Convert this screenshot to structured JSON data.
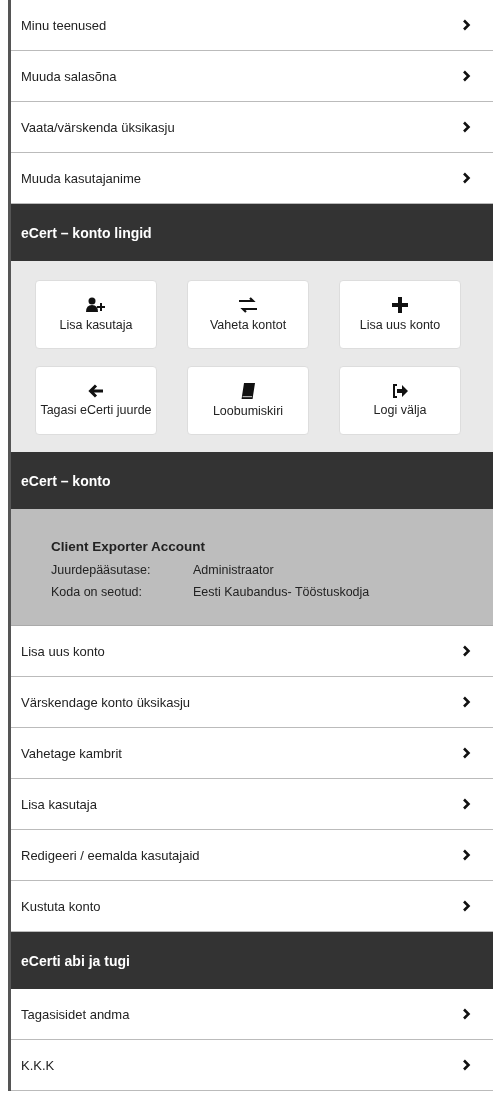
{
  "sections": [
    {
      "kind": "links",
      "items": [
        "Minu teenused",
        "Muuda salasõna",
        "Vaata/värskenda üksikasju",
        "Muuda kasutajanime"
      ]
    },
    {
      "kind": "header",
      "title": "eCert – konto lingid"
    },
    {
      "kind": "buttons",
      "items": [
        "Lisa kasutaja",
        "Vaheta kontot",
        "Lisa uus konto",
        "Tagasi eCerti juurde",
        "Loobumiskiri",
        "Logi välja"
      ]
    },
    {
      "kind": "header",
      "title": "eCert – konto"
    },
    {
      "kind": "account",
      "name": "Client Exporter Account",
      "fields": [
        {
          "label": "Juurdepääsutase:",
          "value": "Administraator"
        },
        {
          "label": "Koda on seotud:",
          "value": "Eesti Kaubandus- Tööstuskodja"
        }
      ]
    },
    {
      "kind": "links",
      "items": [
        "Lisa uus konto",
        "Värskendage konto üksikasju",
        "Vahetage kambrit",
        "Lisa kasutaja",
        "Redigeeri / eemalda kasutajaid",
        "Kustuta konto"
      ]
    },
    {
      "kind": "header",
      "title": "eCerti abi ja tugi"
    },
    {
      "kind": "links",
      "items": [
        "Tagasisidet andma",
        "K.K.K"
      ]
    }
  ]
}
